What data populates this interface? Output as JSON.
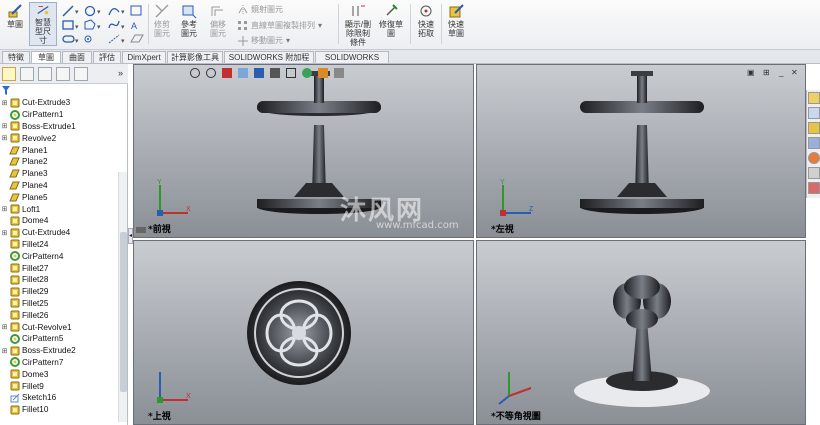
{
  "ribbon": {
    "sketch": "草圖",
    "smart_dim": "智慧型尺寸",
    "trim": "修剪圖元",
    "convert": "參考圖元",
    "offset": "偏移圖元",
    "mirror": "鏡射圖元",
    "linear_pattern": "直線草圖複製排列",
    "move": "移動圖元",
    "display_delete": "顯示/刪除限制條件",
    "repair": "修復草圖",
    "quick_snap": "快速拓取",
    "rapid_sketch": "快速草圖"
  },
  "tabs": [
    "特徵",
    "草圖",
    "曲面",
    "評估",
    "DimXpert",
    "計算影像工具",
    "SOLIDWORKS 附加程式",
    "SOLIDWORKS MBD"
  ],
  "active_tab": 1,
  "tree": [
    {
      "label": "Cut-Extrude3",
      "icon": "cut-extrude-icon",
      "expand": true
    },
    {
      "label": "CirPattern1",
      "icon": "circular-pattern-icon",
      "expand": false
    },
    {
      "label": "Boss-Extrude1",
      "icon": "boss-extrude-icon",
      "expand": true
    },
    {
      "label": "Revolve2",
      "icon": "revolve-icon",
      "expand": true
    },
    {
      "label": "Plane1",
      "icon": "plane-icon",
      "expand": false
    },
    {
      "label": "Plane2",
      "icon": "plane-icon",
      "expand": false
    },
    {
      "label": "Plane3",
      "icon": "plane-icon",
      "expand": false
    },
    {
      "label": "Plane4",
      "icon": "plane-icon",
      "expand": false
    },
    {
      "label": "Plane5",
      "icon": "plane-icon",
      "expand": false
    },
    {
      "label": "Loft1",
      "icon": "loft-icon",
      "expand": true
    },
    {
      "label": "Dome4",
      "icon": "dome-icon",
      "expand": false
    },
    {
      "label": "Cut-Extrude4",
      "icon": "cut-extrude-icon",
      "expand": true
    },
    {
      "label": "Fillet24",
      "icon": "fillet-icon",
      "expand": false
    },
    {
      "label": "CirPattern4",
      "icon": "circular-pattern-icon",
      "expand": false
    },
    {
      "label": "Fillet27",
      "icon": "fillet-icon",
      "expand": false
    },
    {
      "label": "Fillet28",
      "icon": "fillet-icon",
      "expand": false
    },
    {
      "label": "Fillet29",
      "icon": "fillet-icon",
      "expand": false
    },
    {
      "label": "Fillet25",
      "icon": "fillet-icon",
      "expand": false
    },
    {
      "label": "Fillet26",
      "icon": "fillet-icon",
      "expand": false
    },
    {
      "label": "Cut-Revolve1",
      "icon": "cut-revolve-icon",
      "expand": true
    },
    {
      "label": "CirPattern5",
      "icon": "circular-pattern-icon",
      "expand": false
    },
    {
      "label": "Boss-Extrude2",
      "icon": "boss-extrude-icon",
      "expand": true
    },
    {
      "label": "CirPattern7",
      "icon": "circular-pattern-icon",
      "expand": false
    },
    {
      "label": "Dome3",
      "icon": "dome-icon",
      "expand": false
    },
    {
      "label": "Fillet9",
      "icon": "fillet-icon",
      "expand": false
    },
    {
      "label": "Sketch16",
      "icon": "sketch-icon",
      "expand": false
    },
    {
      "label": "Fillet10",
      "icon": "fillet-icon",
      "expand": false
    }
  ],
  "viewports": {
    "front": "*前視",
    "left": "*左視",
    "top": "*上視",
    "iso": "*不等角視圖"
  },
  "watermark": {
    "main": "沐风网",
    "sub": "www.mfcad.com"
  },
  "colors": {
    "accent": "#2a6fd0",
    "model": "#3a3d42",
    "viewport_top": "#c9ccd1",
    "viewport_bottom": "#8a8f96"
  }
}
